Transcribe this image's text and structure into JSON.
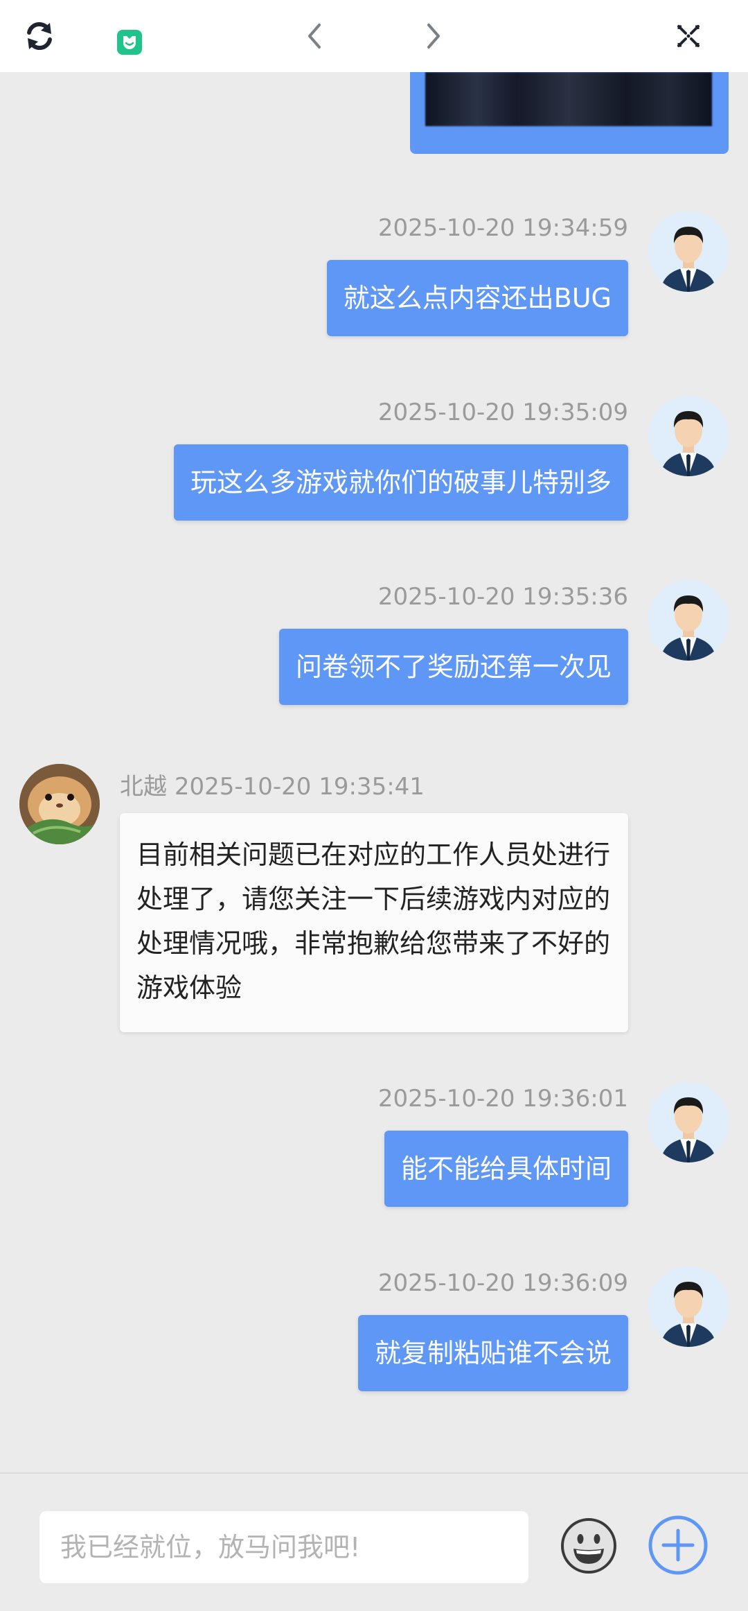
{
  "messages": [
    {
      "timestamp": "2025-10-20 19:34:59",
      "text": "就这么点内容还出BUG"
    },
    {
      "timestamp": "2025-10-20 19:35:09",
      "text": "玩这么多游戏就你们的破事儿特别多"
    },
    {
      "timestamp": "2025-10-20 19:35:36",
      "text": "问卷领不了奖励还第一次见"
    },
    {
      "sender": "北越",
      "timestamp": "2025-10-20 19:35:41",
      "text": "目前相关问题已在对应的工作人员处进行处理了，请您关注一下后续游戏内对应的处理情况哦，非常抱歉给您带来了不好的游戏体验"
    },
    {
      "timestamp": "2025-10-20 19:36:01",
      "text": "能不能给具体时间"
    },
    {
      "timestamp": "2025-10-20 19:36:09",
      "text": "就复制粘贴谁不会说"
    }
  ],
  "input": {
    "placeholder": "我已经就位，放马问我吧!"
  },
  "colors": {
    "user_bubble": "#5e97f6",
    "agent_bubble": "#fbfbfb",
    "background": "#ebebeb",
    "accent_green": "#1ec48a"
  },
  "icons": [
    "refresh-icon",
    "mini-app-icon",
    "back-arrow-icon",
    "forward-arrow-icon",
    "close-icon",
    "emoji-icon",
    "plus-icon"
  ]
}
